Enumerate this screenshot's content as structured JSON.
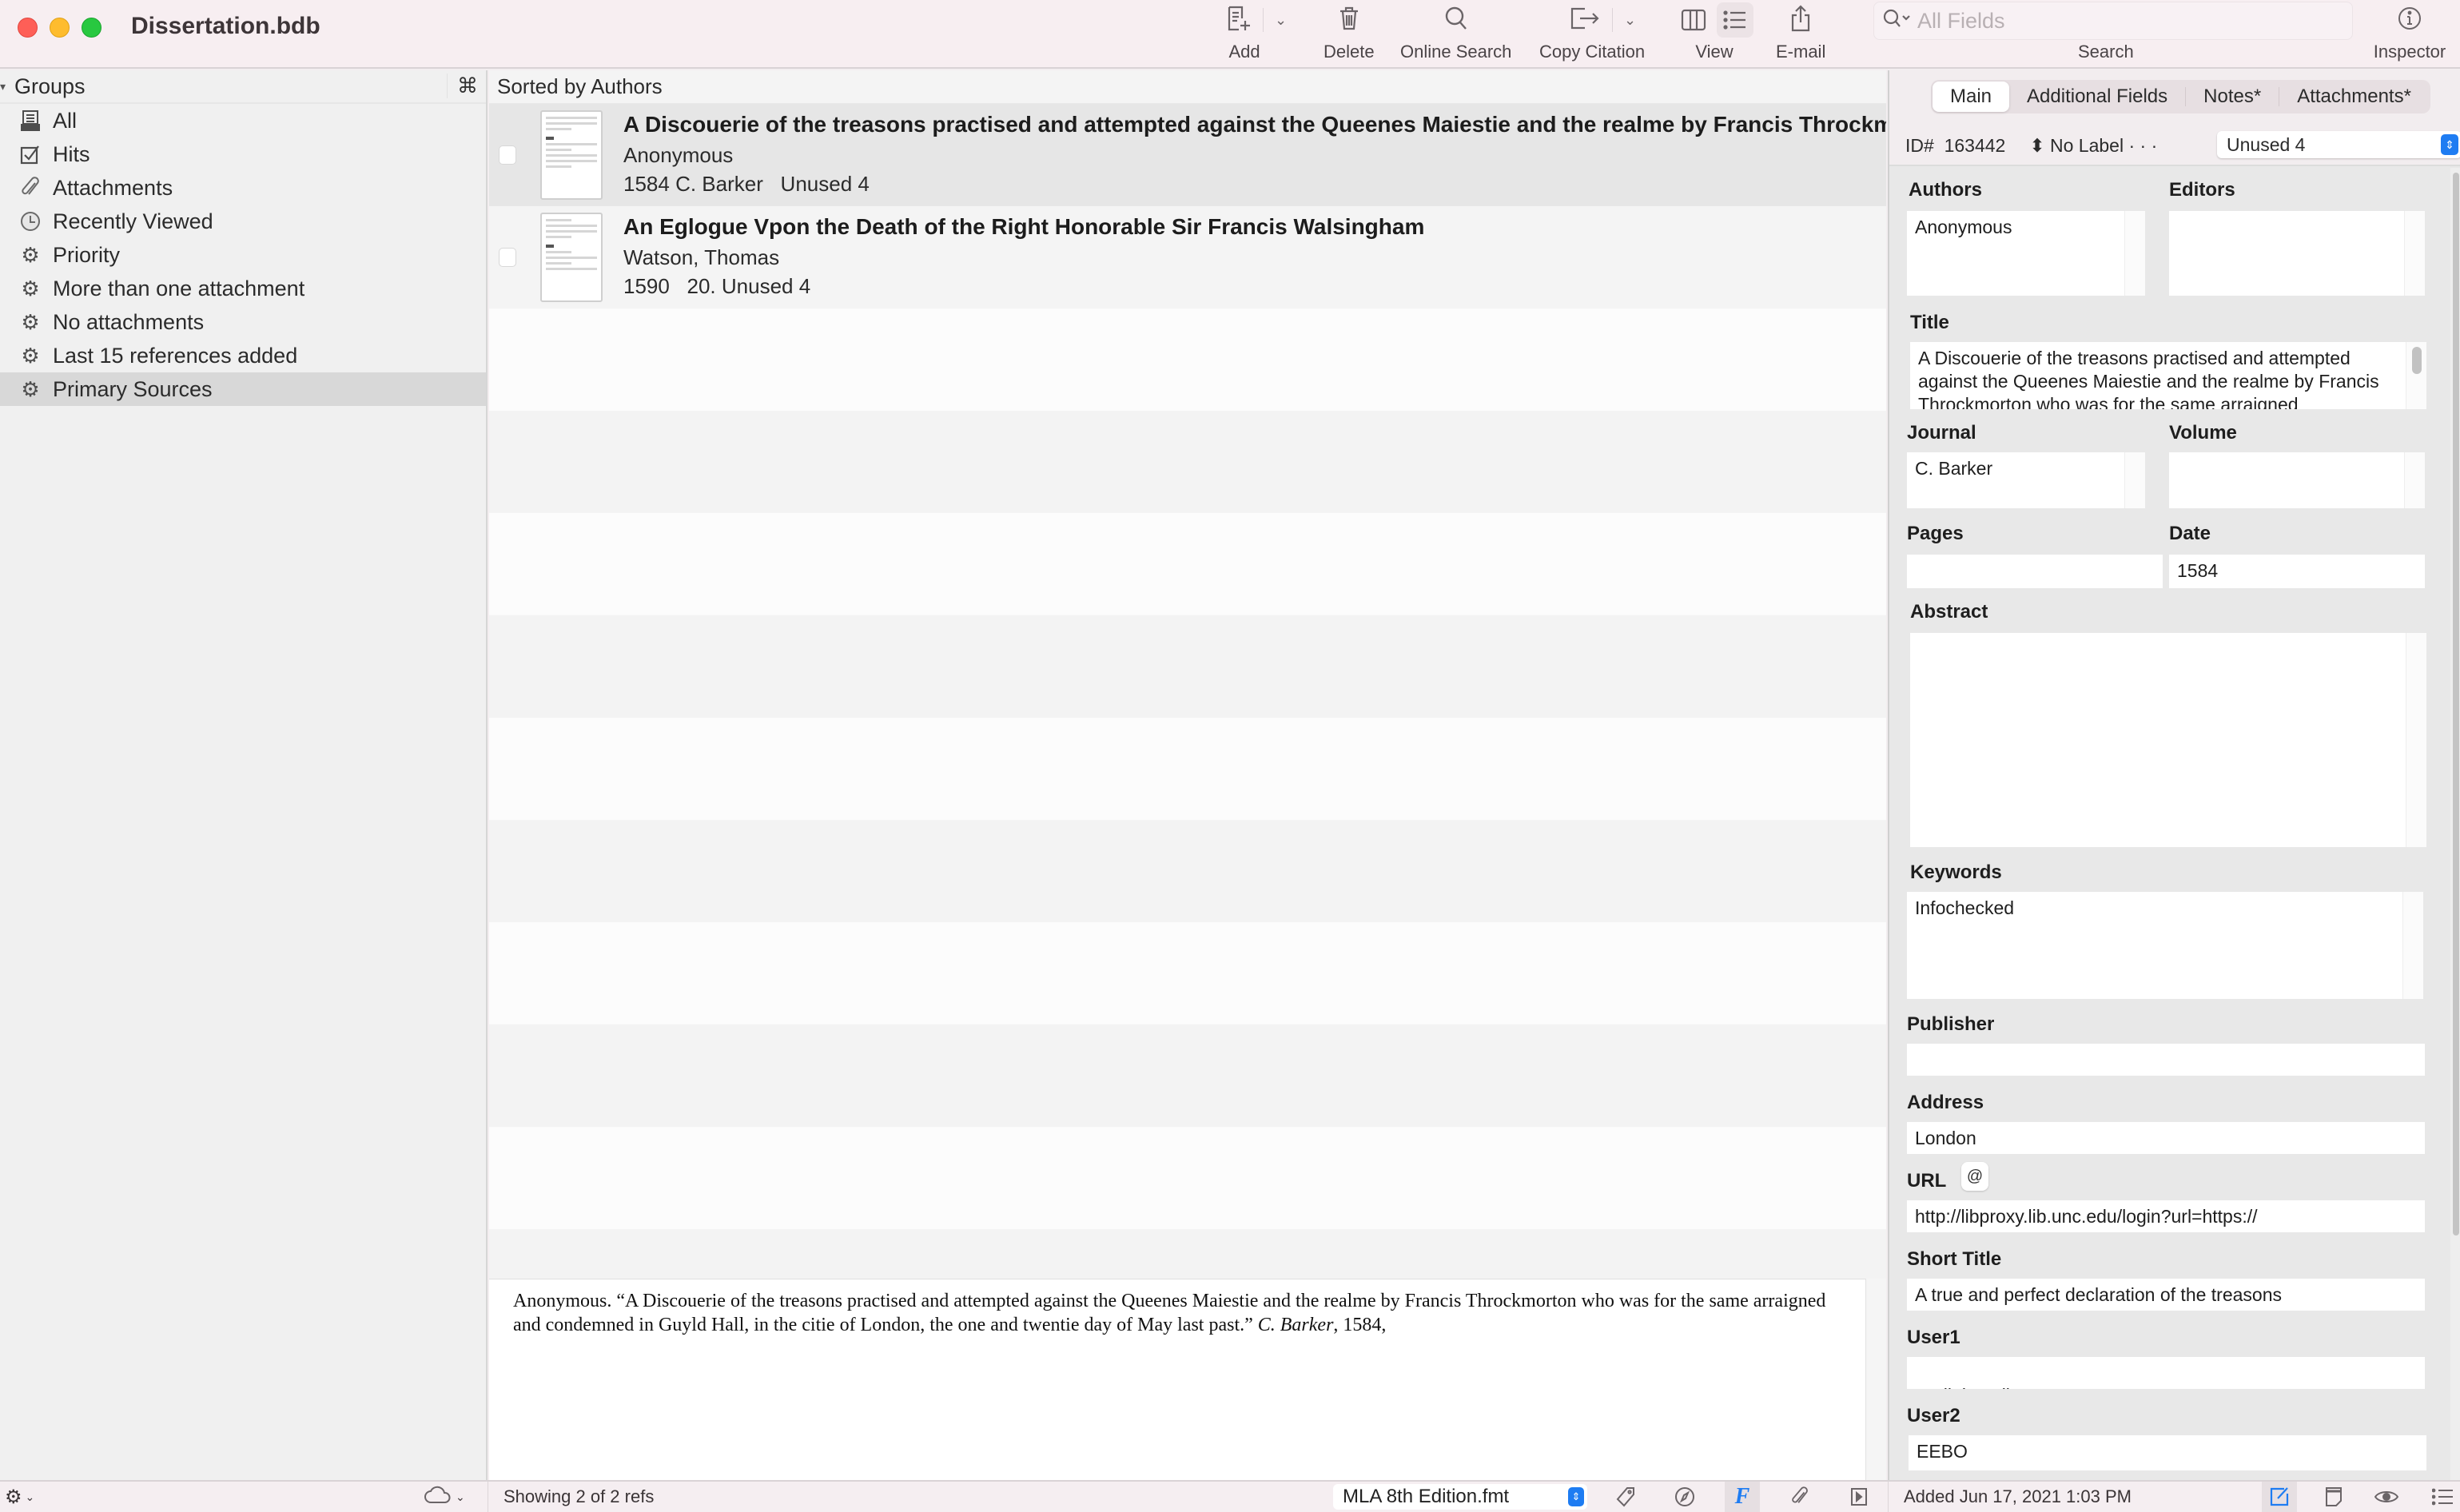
{
  "window": {
    "title": "Dissertation.bdb"
  },
  "toolbar": {
    "add_label": "Add",
    "delete_label": "Delete",
    "online_search_label": "Online Search",
    "copy_citation_label": "Copy Citation",
    "view_label": "View",
    "email_label": "E-mail",
    "search_label": "Search",
    "search_placeholder": "All Fields",
    "search_value": "",
    "inspector_label": "Inspector",
    "active_view": "list"
  },
  "sidebar": {
    "header": "Groups",
    "header_shortcut": "⌘",
    "items": [
      {
        "label": "All",
        "icon": "library-icon",
        "selected": false
      },
      {
        "label": "Hits",
        "icon": "checkbox-icon",
        "selected": false
      },
      {
        "label": "Attachments",
        "icon": "paperclip-icon",
        "selected": false
      },
      {
        "label": "Recently Viewed",
        "icon": "clock-icon",
        "selected": false
      },
      {
        "label": "Priority",
        "icon": "gear-icon",
        "selected": false
      },
      {
        "label": "More than one attachment",
        "icon": "gear-icon",
        "selected": false
      },
      {
        "label": "No attachments",
        "icon": "gear-icon",
        "selected": false
      },
      {
        "label": "Last 15 references added",
        "icon": "gear-icon",
        "selected": false
      },
      {
        "label": "Primary Sources",
        "icon": "gear-icon",
        "selected": true
      }
    ]
  },
  "list": {
    "sort_label": "Sorted by Authors",
    "references": [
      {
        "title": "A Discouerie of the treasons practised and attempted against the Queenes Maiestie and the realme by Francis Throckmorton who was for the same arraigned",
        "author": "Anonymous",
        "details": "1584 C. Barker   Unused 4",
        "checked": false,
        "selected": true
      },
      {
        "title": "An Eglogue Vpon the Death of the Right Honorable Sir Francis Walsingham",
        "author": "Watson, Thomas",
        "details": "1590   20. Unused 4",
        "checked": false,
        "selected": false
      }
    ]
  },
  "preview": {
    "citation_before_italic": "Anonymous. “A Discouerie of the treasons practised and attempted against the Queenes Maiestie and the realme by Francis Throckmorton who was for the same arraigned and condemned in Guyld Hall, in the citie of London, the one and twentie day of May last past.” ",
    "citation_italic": "C. Barker",
    "citation_after_italic": ", 1584,"
  },
  "inspector": {
    "tabs": [
      {
        "label": "Main",
        "active": true
      },
      {
        "label": "Additional Fields",
        "active": false
      },
      {
        "label": "Notes*",
        "active": false
      },
      {
        "label": "Attachments*",
        "active": false
      }
    ],
    "id_label": "ID#",
    "id_value": "163442",
    "label_popup": "No Label",
    "label_dots": "· · ·",
    "status_value": "Unused 4",
    "fields": {
      "authors": {
        "label": "Authors",
        "value": "Anonymous"
      },
      "editors": {
        "label": "Editors",
        "value": ""
      },
      "title": {
        "label": "Title",
        "value": "A Discouerie of the treasons practised and attempted against the Queenes Maiestie and the realme by Francis Throckmorton who was for the same arraigned"
      },
      "journal": {
        "label": "Journal",
        "value": "C. Barker"
      },
      "volume": {
        "label": "Volume",
        "value": ""
      },
      "pages": {
        "label": "Pages",
        "value": ""
      },
      "date": {
        "label": "Date",
        "value": "1584"
      },
      "abstract": {
        "label": "Abstract",
        "value": ""
      },
      "keywords": {
        "label": "Keywords",
        "value": "Infochecked"
      },
      "publisher": {
        "label": "Publisher",
        "value": ""
      },
      "address": {
        "label": "Address",
        "value": "London"
      },
      "url": {
        "label": "URL",
        "value": "http://libproxy.lib.unc.edu/login?url=https://",
        "button": "@"
      },
      "short_title": {
        "label": "Short Title",
        "value": "A true and perfect declaration of the treasons"
      },
      "user1": {
        "label": "User1",
        "value": "Bodleian Library"
      },
      "user2": {
        "label": "User2",
        "value": "EEBO"
      }
    }
  },
  "statusbar": {
    "ref_count": "Showing 2 of 2 refs",
    "citation_format": "MLA 8th Edition.fmt",
    "added_date": "Added Jun 17, 2021 1:03 PM"
  },
  "colors": {
    "accent": "#1e7cf2",
    "close": "#fe5f57",
    "minimize": "#febc2e",
    "zoom": "#28c840"
  }
}
